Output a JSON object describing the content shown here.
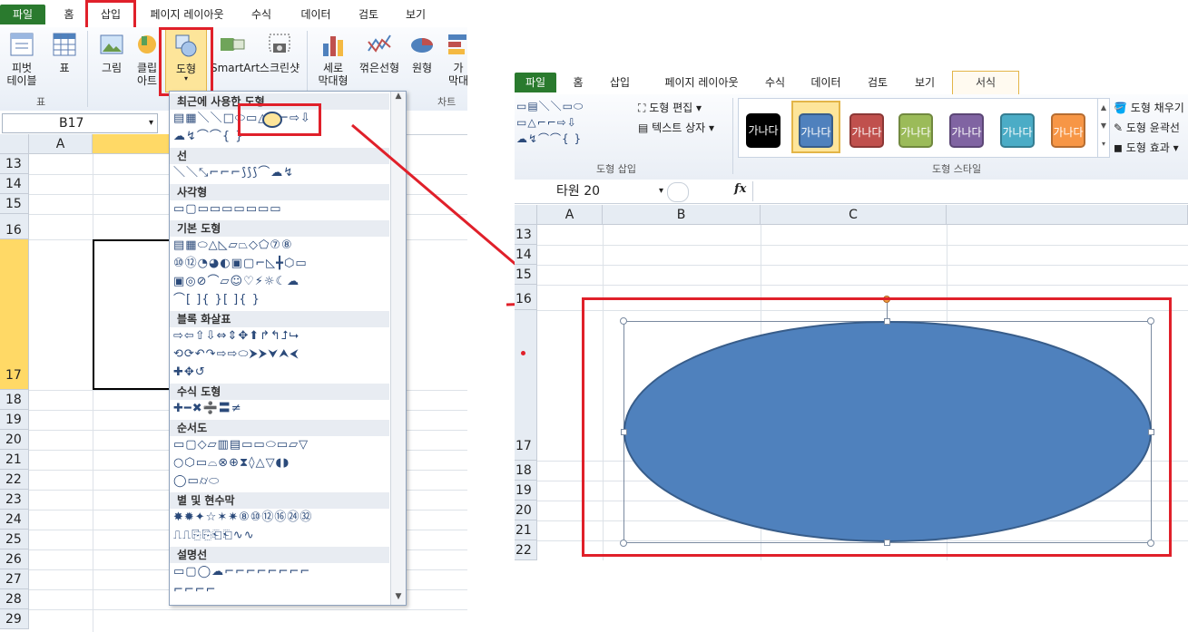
{
  "left": {
    "tabs": [
      "파일",
      "홈",
      "삽입",
      "페이지 레이아웃",
      "수식",
      "데이터",
      "검토",
      "보기"
    ],
    "ribbon": {
      "pivot_label": "피벗\n테이블",
      "table_label": "표",
      "group_table": "표",
      "picture_label": "그림",
      "clipart_label": "클립\n아트",
      "shapes_label": "도형",
      "smartart_label": "SmartArt",
      "screenshot_label": "스크린샷",
      "column_chart_label": "세로\n막대형",
      "line_chart_label": "꺾은선형",
      "pie_chart_label": "원형",
      "bar_chart_label": "가\n막대",
      "group_chart": "차트"
    },
    "name_box": "B17",
    "columns": [
      "A"
    ],
    "rows": [
      "13",
      "14",
      "15",
      "16",
      "17",
      "18",
      "19",
      "20",
      "21",
      "22",
      "23",
      "24",
      "25",
      "26",
      "27",
      "28",
      "29"
    ],
    "dropdown": {
      "categories": [
        "최근에 사용한 도형",
        "선",
        "사각형",
        "기본 도형",
        "블록 화살표",
        "수식 도형",
        "순서도",
        "별 및 현수막",
        "설명선"
      ]
    }
  },
  "right": {
    "tabs": [
      "파일",
      "홈",
      "삽입",
      "페이지 레이아웃",
      "수식",
      "데이터",
      "검토",
      "보기",
      "서식"
    ],
    "ribbon": {
      "edit_shape": "도형 편집",
      "text_box": "텍스트 상자",
      "group_insert_shape": "도형 삽입",
      "style_text": "가나다",
      "group_shape_styles": "도형 스타일",
      "shape_fill": "도형 채우기",
      "shape_outline": "도형 윤곽선",
      "shape_effects": "도형 효과"
    },
    "name_box": "타원 20",
    "fx": "fx",
    "columns": [
      "A",
      "B",
      "C"
    ],
    "rows": [
      "13",
      "14",
      "15",
      "16",
      "17",
      "18",
      "19",
      "20",
      "21",
      "22"
    ]
  },
  "colors": {
    "highlight_red": "#e0202a",
    "ellipse_fill": "#4f81bd",
    "ellipse_stroke": "#385d8a",
    "file_tab": "#2a7a2e",
    "selected_row_header": "#ffd966"
  },
  "style_swatches": [
    "#000000",
    "#4f81bd",
    "#c0504d",
    "#9bbb59",
    "#8064a2",
    "#4bacc6",
    "#f79646"
  ]
}
